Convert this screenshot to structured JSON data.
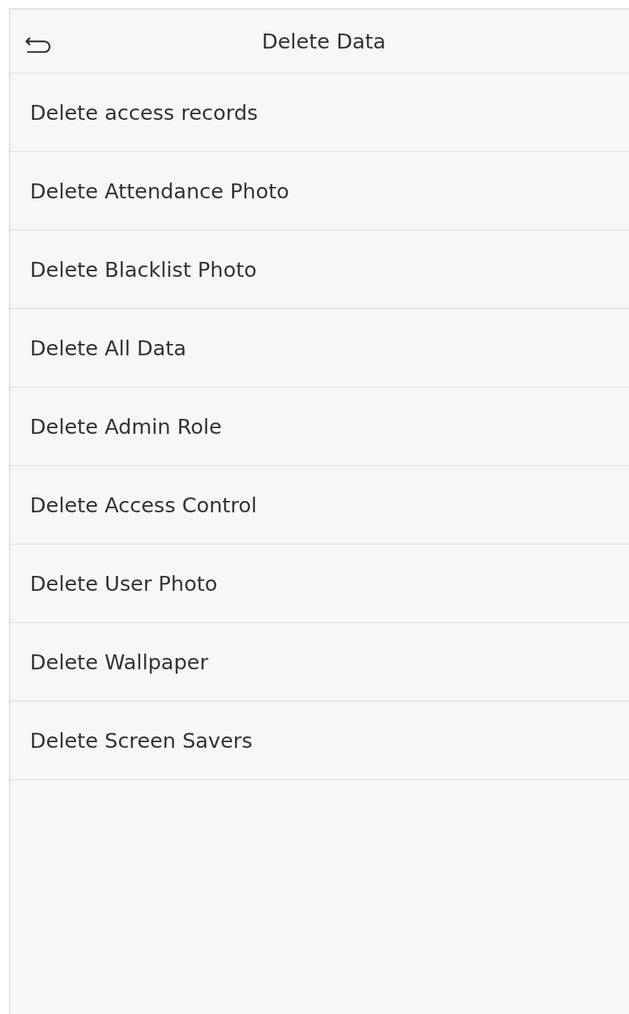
{
  "header": {
    "title": "Delete Data"
  },
  "menu_items": [
    {
      "label": "Delete access records"
    },
    {
      "label": "Delete Attendance Photo"
    },
    {
      "label": "Delete Blacklist Photo"
    },
    {
      "label": "Delete All Data"
    },
    {
      "label": "Delete Admin Role"
    },
    {
      "label": "Delete Access Control"
    },
    {
      "label": "Delete User Photo"
    },
    {
      "label": "Delete Wallpaper"
    },
    {
      "label": "Delete Screen Savers"
    }
  ]
}
